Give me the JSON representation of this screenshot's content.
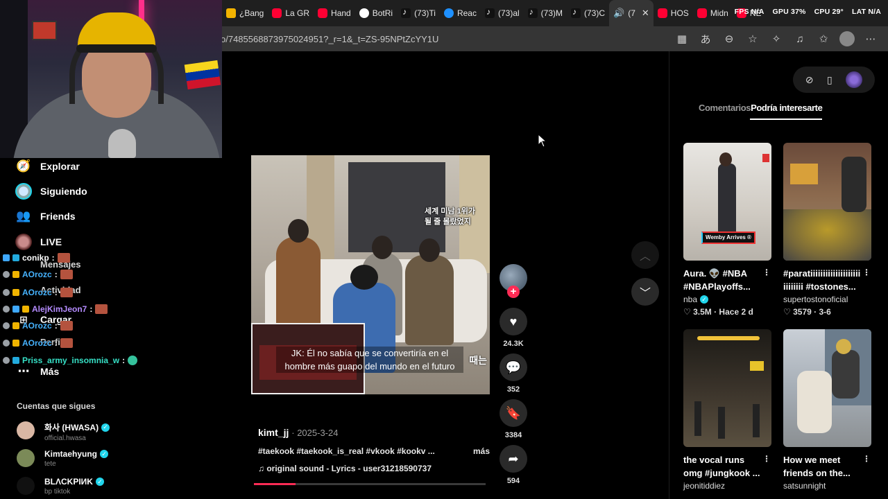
{
  "browser": {
    "tabs": [
      {
        "label": "¿Bang",
        "favicon": "chrome"
      },
      {
        "label": "La GR",
        "favicon": "youtube"
      },
      {
        "label": "Hand",
        "favicon": "youtube"
      },
      {
        "label": "BotRi",
        "favicon": "bot"
      },
      {
        "label": "(73)Ti",
        "favicon": "tiktok"
      },
      {
        "label": "Reac",
        "favicon": "react"
      },
      {
        "label": "(73)al",
        "favicon": "tiktok"
      },
      {
        "label": "(73)M",
        "favicon": "tiktok"
      },
      {
        "label": "(73)C",
        "favicon": "tiktok"
      },
      {
        "label": "(7",
        "favicon": "speaker",
        "active": true
      },
      {
        "label": "HOS",
        "favicon": "youtube"
      },
      {
        "label": "Midn",
        "favicon": "youtube"
      },
      {
        "label": "NE",
        "favicon": "youtube"
      }
    ],
    "hud": {
      "fps": "FPS N/A",
      "gpu": "GPU 37%",
      "cpu": "CPU 29°",
      "lat": "LAT N/A"
    },
    "url": "o/7485568873975024951?_r=1&_t=ZS-95NPtZcYY1U"
  },
  "sidebar": {
    "nav": [
      {
        "label": "Explorar",
        "icon": "compass-icon"
      },
      {
        "label": "Siguiendo",
        "icon": "following-avatar-icon"
      },
      {
        "label": "Friends",
        "icon": "friends-icon"
      },
      {
        "label": "LIVE",
        "icon": "live-icon"
      },
      {
        "label": "Mensajes",
        "icon": "messages-icon"
      },
      {
        "label": "Actividad",
        "icon": "activity-icon"
      },
      {
        "label": "Cargar",
        "icon": "upload-icon"
      },
      {
        "label": "Perfil",
        "icon": "profile-icon"
      },
      {
        "label": "Más",
        "icon": "more-icon"
      }
    ],
    "following_title": "Cuentas que sigues",
    "accounts": [
      {
        "name": "화사 (HWASA)",
        "handle": "official.hwasa",
        "verified": true
      },
      {
        "name": "Kimtaehyung",
        "handle": "tete",
        "verified": true
      },
      {
        "name": "BLΛCKPIИK",
        "handle": "bp tiktok",
        "verified": true
      }
    ]
  },
  "chat": [
    {
      "user": "conikp",
      "color": "white"
    },
    {
      "user": "AOrozc",
      "color": "blue"
    },
    {
      "user": "AOrozc",
      "color": "blue"
    },
    {
      "user": "AlejKimJeon7",
      "color": "purple"
    },
    {
      "user": "AOrozc",
      "color": "blue"
    },
    {
      "user": "AOrozc",
      "color": "blue"
    },
    {
      "user": "Priss_army_insomnia_w",
      "color": "aqua"
    }
  ],
  "video": {
    "overlay_korean": "세계 미남 1위가 될 줄 몰랐었지",
    "overlay_korean2": "때는",
    "subtitle": "JK: Él no sabía que se convertiría en el hombre más guapo del mundo en el futuro",
    "author": "kimt_jj",
    "date": "· 2025-3-24",
    "description": "#taekook #taekook_is_real #vkook #kookv ...",
    "more": "más",
    "sound": "♫  original sound - Lyrics - user31218590737",
    "progress": 0.18
  },
  "actions": {
    "likes": "24.3K",
    "comments": "352",
    "saves": "3384",
    "shares": "594"
  },
  "right_panel": {
    "tab_comments": "Comentarios",
    "tab_interest": "Podría interesarte",
    "cards": [
      {
        "title": "Aura. 👽 #NBA #NBAPlayoffs...",
        "author": "nba",
        "verified": true,
        "stats": "♡ 3.5M · Hace 2 d",
        "badge": "Wemby Arrives ®"
      },
      {
        "title": "#paratiiiiiiiiiiiiiiiiiiii iiiiiiii #tostones...",
        "author": "supertostonoficial",
        "verified": false,
        "stats": "♡ 3579 · 3-6"
      },
      {
        "title": "the vocal runs omg #jungkook ...",
        "author": "jeonitiddiez",
        "verified": false,
        "stats": ""
      },
      {
        "title": "How we meet friends on the...",
        "author": "satsunnight",
        "verified": false,
        "stats": ""
      }
    ]
  }
}
